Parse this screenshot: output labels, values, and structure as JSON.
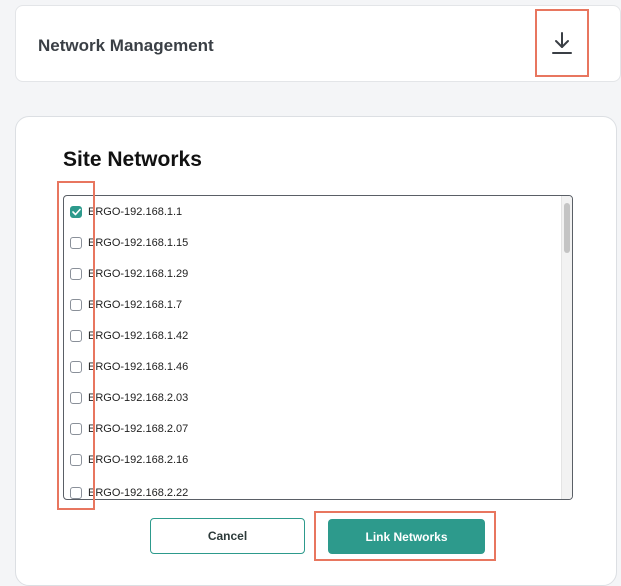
{
  "header": {
    "title": "Network Management",
    "download_icon": "download-icon"
  },
  "modal": {
    "title": "Site Networks",
    "networks": [
      {
        "label": "ERGO-192.168.1.1",
        "checked": true
      },
      {
        "label": "ERGO-192.168.1.15",
        "checked": false
      },
      {
        "label": "ERGO-192.168.1.29",
        "checked": false
      },
      {
        "label": "ERGO-192.168.1.7",
        "checked": false
      },
      {
        "label": "ERGO-192.168.1.42",
        "checked": false
      },
      {
        "label": "ERGO-192.168.1.46",
        "checked": false
      },
      {
        "label": "ERGO-192.168.2.03",
        "checked": false
      },
      {
        "label": "ERGO-192.168.2.07",
        "checked": false
      },
      {
        "label": "ERGO-192.168.2.16",
        "checked": false
      },
      {
        "label": "ERGO-192.168.2.22",
        "checked": false
      }
    ],
    "cancel_label": "Cancel",
    "link_label": "Link Networks"
  },
  "colors": {
    "accent": "#2d9a8c",
    "highlight": "#e8765f"
  }
}
